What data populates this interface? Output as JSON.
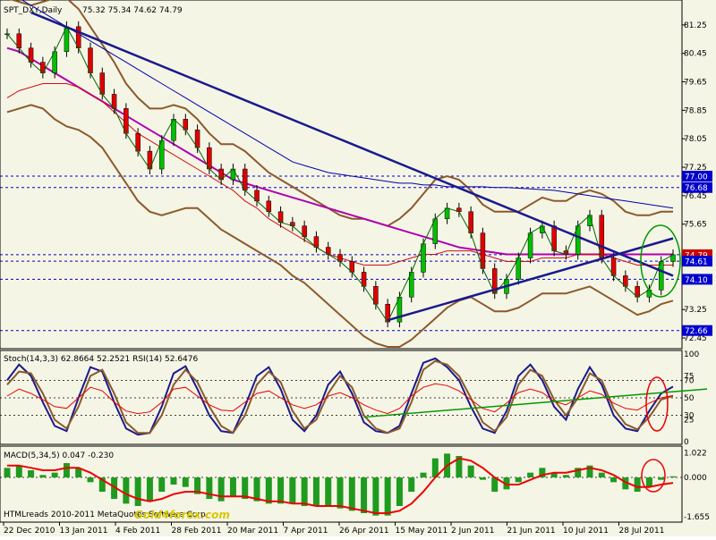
{
  "chart_data": {
    "type": "line",
    "main": {
      "header": {
        "symbol": "SPT_DXY,Daily",
        "ohlc": "75.32 75.34 74.62 74.79"
      },
      "y_ticks": [
        81.25,
        80.45,
        79.65,
        78.85,
        78.05,
        77.25,
        76.45,
        75.65,
        74.85,
        74.05,
        73.25,
        72.45
      ],
      "y_range": [
        72.2,
        81.9
      ],
      "price_badges": [
        {
          "label": "77.00",
          "value": 77.0
        },
        {
          "label": "76.68",
          "value": 76.68
        },
        {
          "label": "74.79",
          "value": 74.79
        },
        {
          "label": "74.61",
          "value": 74.61
        },
        {
          "label": "74.10",
          "value": 74.1
        },
        {
          "label": "72.66",
          "value": 72.66
        }
      ],
      "series": [
        {
          "name": "SPT_DXY close",
          "values": [
            81.0,
            80.6,
            80.2,
            79.9,
            80.5,
            81.2,
            80.6,
            79.9,
            79.3,
            78.9,
            78.2,
            77.7,
            77.2,
            78.0,
            78.6,
            78.3,
            77.8,
            77.2,
            76.9,
            77.2,
            76.6,
            76.3,
            76.0,
            75.7,
            75.6,
            75.3,
            75.0,
            74.8,
            74.6,
            74.3,
            73.9,
            73.4,
            72.9,
            73.6,
            74.3,
            75.1,
            75.8,
            76.1,
            76.0,
            75.4,
            74.4,
            73.7,
            74.1,
            74.7,
            75.4,
            75.6,
            74.9,
            74.8,
            75.6,
            75.9,
            74.7,
            74.2,
            73.9,
            73.6,
            73.8,
            74.6,
            74.79
          ]
        },
        {
          "name": "Moving average 1",
          "values": [
            79.2,
            79.4,
            79.5,
            79.6,
            79.6,
            79.6,
            79.5,
            79.3,
            79.1,
            78.8,
            78.5,
            78.2,
            78.0,
            77.8,
            77.6,
            77.4,
            77.2,
            77.0,
            76.8,
            76.6,
            76.3,
            76.1,
            75.8,
            75.6,
            75.4,
            75.2,
            75.0,
            74.8,
            74.7,
            74.6,
            74.5,
            74.5,
            74.5,
            74.6,
            74.7,
            74.8,
            74.8,
            74.9,
            74.9,
            74.9,
            74.8,
            74.7,
            74.6,
            74.6,
            74.6,
            74.7,
            74.7,
            74.7,
            74.8,
            74.8,
            74.8,
            74.7,
            74.6,
            74.5,
            74.5,
            74.5,
            74.5
          ]
        },
        {
          "name": "Moving average 2",
          "values": [
            80.6,
            80.5,
            80.3,
            80.1,
            79.9,
            79.7,
            79.5,
            79.3,
            79.1,
            78.9,
            78.7,
            78.5,
            78.3,
            78.1,
            77.9,
            77.7,
            77.5,
            77.3,
            77.1,
            76.9,
            76.8,
            76.7,
            76.6,
            76.5,
            76.4,
            76.3,
            76.2,
            76.1,
            76.0,
            75.9,
            75.8,
            75.7,
            75.6,
            75.5,
            75.4,
            75.3,
            75.2,
            75.1,
            75.0,
            74.95,
            74.9,
            74.85,
            74.8,
            74.8,
            74.8,
            74.8,
            74.8,
            74.8,
            74.8,
            74.8,
            74.8,
            74.8,
            74.8,
            74.8,
            74.8,
            74.8,
            74.8
          ]
        },
        {
          "name": "Moving average 3",
          "values": [
            82.2,
            82.0,
            81.8,
            81.6,
            81.4,
            81.2,
            81.0,
            80.8,
            80.6,
            80.4,
            80.2,
            80.0,
            79.8,
            79.6,
            79.4,
            79.2,
            79.0,
            78.8,
            78.6,
            78.4,
            78.2,
            78.0,
            77.8,
            77.6,
            77.4,
            77.3,
            77.2,
            77.1,
            77.05,
            77.0,
            76.95,
            76.9,
            76.85,
            76.8,
            76.8,
            76.75,
            76.75,
            76.7,
            76.7,
            76.7,
            76.7,
            76.68,
            76.68,
            76.66,
            76.64,
            76.62,
            76.6,
            76.55,
            76.5,
            76.45,
            76.4,
            76.35,
            76.3,
            76.25,
            76.2,
            76.15,
            76.1
          ]
        },
        {
          "name": "Band upper",
          "values": [
            82.0,
            81.9,
            81.8,
            81.9,
            82.0,
            82.0,
            81.7,
            81.2,
            80.7,
            80.2,
            79.6,
            79.2,
            78.9,
            78.9,
            79.0,
            78.9,
            78.6,
            78.2,
            77.9,
            77.9,
            77.7,
            77.4,
            77.1,
            76.9,
            76.7,
            76.5,
            76.3,
            76.1,
            75.9,
            75.8,
            75.8,
            75.7,
            75.6,
            75.8,
            76.1,
            76.5,
            76.9,
            77.0,
            76.9,
            76.6,
            76.2,
            76.0,
            76.0,
            76.0,
            76.2,
            76.4,
            76.3,
            76.3,
            76.5,
            76.6,
            76.5,
            76.3,
            76.0,
            75.9,
            75.9,
            76.0,
            76.0
          ]
        },
        {
          "name": "Band lower",
          "values": [
            78.8,
            78.9,
            79.0,
            78.9,
            78.6,
            78.4,
            78.3,
            78.1,
            77.8,
            77.3,
            76.8,
            76.3,
            76.0,
            75.9,
            76.0,
            76.1,
            76.1,
            75.8,
            75.5,
            75.3,
            75.1,
            74.9,
            74.7,
            74.5,
            74.2,
            74.0,
            73.7,
            73.4,
            73.1,
            72.8,
            72.5,
            72.3,
            72.2,
            72.2,
            72.4,
            72.7,
            73.0,
            73.3,
            73.5,
            73.6,
            73.4,
            73.2,
            73.2,
            73.3,
            73.5,
            73.7,
            73.7,
            73.7,
            73.8,
            73.9,
            73.7,
            73.5,
            73.3,
            73.1,
            73.2,
            73.4,
            73.5
          ]
        }
      ],
      "trendlines": [
        {
          "from": [
            2,
            81.6
          ],
          "to": [
            56,
            74.2
          ]
        },
        {
          "from": [
            32,
            72.95
          ],
          "to": [
            56,
            75.25
          ]
        }
      ],
      "horizontal_levels": [
        77.0,
        76.68,
        74.79,
        74.61,
        74.1,
        72.66
      ]
    },
    "stoch": {
      "header": "Stoch(14,3,3) 62.8664 52.2521 RSI(14) 52.6476",
      "y_ticks": [
        100,
        75,
        70,
        50,
        30,
        25,
        0
      ],
      "y_range": [
        0,
        100
      ],
      "series": [
        {
          "name": "Stoch main",
          "values": [
            70,
            88,
            75,
            45,
            18,
            12,
            50,
            85,
            80,
            45,
            15,
            8,
            10,
            40,
            78,
            86,
            60,
            30,
            12,
            10,
            40,
            75,
            85,
            60,
            25,
            12,
            30,
            65,
            80,
            55,
            22,
            12,
            10,
            18,
            55,
            90,
            95,
            85,
            70,
            40,
            15,
            10,
            35,
            75,
            88,
            70,
            40,
            25,
            60,
            85,
            65,
            30,
            15,
            12,
            35,
            55,
            62.87
          ]
        },
        {
          "name": "Stoch signal",
          "values": [
            65,
            80,
            78,
            55,
            25,
            15,
            40,
            75,
            82,
            55,
            22,
            10,
            10,
            30,
            65,
            82,
            68,
            40,
            18,
            10,
            30,
            65,
            80,
            68,
            35,
            15,
            25,
            55,
            75,
            62,
            30,
            15,
            10,
            15,
            45,
            82,
            92,
            88,
            75,
            50,
            22,
            12,
            28,
            65,
            82,
            75,
            48,
            30,
            50,
            78,
            70,
            38,
            20,
            14,
            28,
            48,
            52.25
          ]
        },
        {
          "name": "RSI",
          "values": [
            52,
            60,
            55,
            48,
            40,
            38,
            50,
            62,
            58,
            45,
            35,
            32,
            34,
            45,
            60,
            62,
            52,
            42,
            36,
            35,
            45,
            55,
            58,
            50,
            42,
            38,
            42,
            52,
            56,
            50,
            42,
            36,
            32,
            38,
            52,
            62,
            66,
            64,
            58,
            48,
            38,
            34,
            44,
            56,
            60,
            56,
            46,
            42,
            50,
            58,
            54,
            44,
            38,
            36,
            44,
            50,
            52.65
          ]
        }
      ],
      "trendline": {
        "from": [
          30,
          28
        ],
        "to": [
          56,
          54
        ]
      }
    },
    "macd": {
      "header": "MACD(5,34,5) 0.047 -0.230",
      "y_ticks": [
        1.022,
        0.0,
        -1.655
      ],
      "y_range": [
        -1.8,
        1.2
      ],
      "histogram": [
        0.4,
        0.5,
        0.3,
        0.1,
        0.2,
        0.6,
        0.4,
        -0.2,
        -0.6,
        -0.9,
        -1.1,
        -1.2,
        -1.0,
        -0.6,
        -0.3,
        -0.4,
        -0.7,
        -0.9,
        -1.0,
        -0.8,
        -0.9,
        -1.0,
        -1.1,
        -1.1,
        -1.1,
        -1.2,
        -1.2,
        -1.2,
        -1.3,
        -1.4,
        -1.5,
        -1.6,
        -1.6,
        -1.2,
        -0.6,
        0.2,
        0.8,
        1.0,
        0.9,
        0.5,
        -0.1,
        -0.6,
        -0.5,
        -0.2,
        0.2,
        0.4,
        0.2,
        0.1,
        0.4,
        0.5,
        0.2,
        -0.2,
        -0.5,
        -0.6,
        -0.4,
        -0.1,
        0.047
      ],
      "signal": [
        0.5,
        0.5,
        0.4,
        0.3,
        0.3,
        0.4,
        0.4,
        0.2,
        -0.1,
        -0.4,
        -0.7,
        -0.9,
        -1.0,
        -0.9,
        -0.7,
        -0.6,
        -0.6,
        -0.7,
        -0.8,
        -0.8,
        -0.8,
        -0.9,
        -1.0,
        -1.0,
        -1.1,
        -1.1,
        -1.2,
        -1.2,
        -1.2,
        -1.3,
        -1.4,
        -1.5,
        -1.5,
        -1.4,
        -1.1,
        -0.6,
        0.0,
        0.5,
        0.8,
        0.7,
        0.4,
        0.0,
        -0.3,
        -0.3,
        -0.1,
        0.1,
        0.2,
        0.2,
        0.3,
        0.4,
        0.3,
        0.1,
        -0.2,
        -0.4,
        -0.4,
        -0.3,
        -0.23
      ]
    },
    "x_labels": [
      "22 Dec 2010",
      "13 Jan 2011",
      "4 Feb 2011",
      "28 Feb 2011",
      "20 Mar 2011",
      "7 Apr 2011",
      "26 Apr 2011",
      "15 May 2011",
      "2 Jun 2011",
      "21 Jun 2011",
      "10 Jul 2011",
      "28 Jul 2011"
    ],
    "footer_text": "HTMLreads 2010-2011 MetaQuotes Software Corp.",
    "watermark": "Gold4forex.com"
  }
}
